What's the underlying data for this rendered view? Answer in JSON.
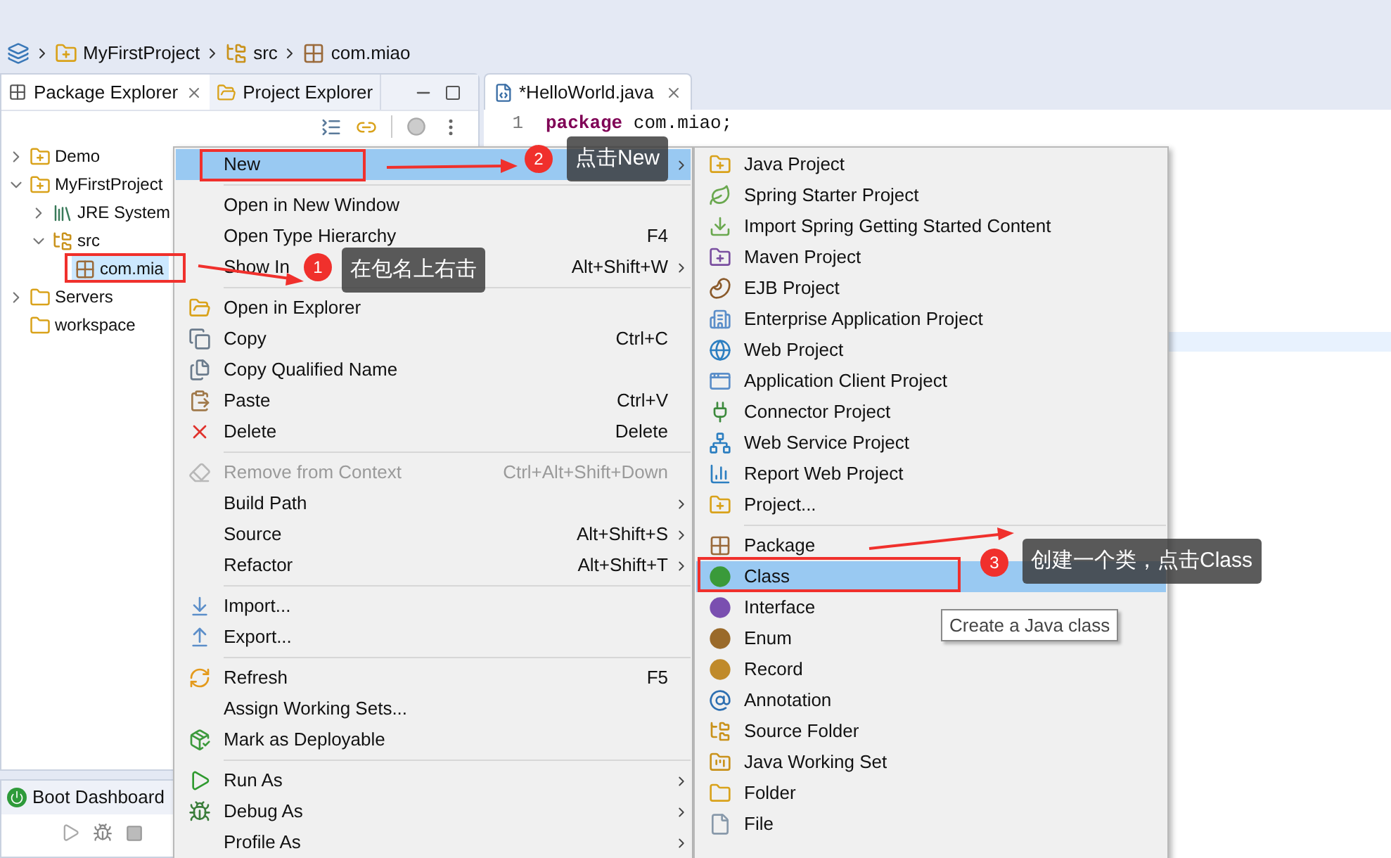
{
  "breadcrumb": [
    {
      "kind": "project",
      "label": "MyFirstProject"
    },
    {
      "kind": "source-folder",
      "label": "src"
    },
    {
      "kind": "package",
      "label": "com.miao"
    }
  ],
  "explorer": {
    "tabs": [
      {
        "label": "Package Explorer",
        "selected": true
      },
      {
        "label": "Project Explorer",
        "selected": false
      }
    ],
    "tree": [
      {
        "label": "Demo",
        "kind": "project",
        "expanded": false,
        "selected": false
      },
      {
        "label": "MyFirstProject",
        "kind": "project",
        "expanded": true,
        "selected": false,
        "children": [
          {
            "label": "JRE System",
            "kind": "library",
            "expanded": false,
            "selected": false
          },
          {
            "label": "src",
            "kind": "source-folder",
            "expanded": true,
            "selected": false,
            "children": [
              {
                "label": "com.mia",
                "kind": "package",
                "selected": true
              }
            ]
          }
        ]
      },
      {
        "label": "Servers",
        "kind": "folder",
        "expanded": false,
        "selected": false
      },
      {
        "label": "workspace",
        "kind": "folder",
        "selected": false
      }
    ]
  },
  "editor": {
    "tab": "*HelloWorld.java",
    "lines": [
      {
        "number": "1",
        "tokens": [
          {
            "text": "package",
            "kind": "keyword"
          },
          {
            "text": " com.miao;",
            "kind": "plain"
          }
        ]
      }
    ]
  },
  "context_menu": {
    "items": [
      {
        "kind": "plain",
        "label": "New",
        "submenu": true,
        "selected": true,
        "disabled": false
      },
      {
        "kind": "separator"
      },
      {
        "kind": "plain",
        "label": "Open in New Window",
        "selected": false,
        "disabled": false
      },
      {
        "kind": "plain",
        "label": "Open Type Hierarchy",
        "shortcut": "F4",
        "selected": false,
        "disabled": false
      },
      {
        "kind": "plain",
        "label": "Show In",
        "shortcut": "Alt+Shift+W",
        "submenu": true,
        "selected": false,
        "disabled": false
      },
      {
        "kind": "separator"
      },
      {
        "kind": "open-explorer",
        "label": "Open in Explorer",
        "selected": false,
        "disabled": false
      },
      {
        "kind": "copy",
        "label": "Copy",
        "shortcut": "Ctrl+C",
        "selected": false,
        "disabled": false
      },
      {
        "kind": "copy-name",
        "label": "Copy Qualified Name",
        "selected": false,
        "disabled": false
      },
      {
        "kind": "paste",
        "label": "Paste",
        "shortcut": "Ctrl+V",
        "selected": false,
        "disabled": false
      },
      {
        "kind": "delete",
        "label": "Delete",
        "shortcut": "Delete",
        "selected": false,
        "disabled": false
      },
      {
        "kind": "separator"
      },
      {
        "kind": "remove",
        "label": "Remove from Context",
        "shortcut": "Ctrl+Alt+Shift+Down",
        "selected": false,
        "disabled": true
      },
      {
        "kind": "plain",
        "label": "Build Path",
        "submenu": true,
        "selected": false,
        "disabled": false
      },
      {
        "kind": "plain",
        "label": "Source",
        "shortcut": "Alt+Shift+S",
        "submenu": true,
        "selected": false,
        "disabled": false
      },
      {
        "kind": "plain",
        "label": "Refactor",
        "shortcut": "Alt+Shift+T",
        "submenu": true,
        "selected": false,
        "disabled": false
      },
      {
        "kind": "separator"
      },
      {
        "kind": "import",
        "label": "Import...",
        "selected": false,
        "disabled": false
      },
      {
        "kind": "export",
        "label": "Export...",
        "selected": false,
        "disabled": false
      },
      {
        "kind": "separator"
      },
      {
        "kind": "refresh",
        "label": "Refresh",
        "shortcut": "F5",
        "selected": false,
        "disabled": false
      },
      {
        "kind": "plain",
        "label": "Assign Working Sets...",
        "selected": false,
        "disabled": false
      },
      {
        "kind": "deploy",
        "label": "Mark as Deployable",
        "selected": false,
        "disabled": false
      },
      {
        "kind": "separator"
      },
      {
        "kind": "run",
        "label": "Run As",
        "submenu": true,
        "selected": false,
        "disabled": false
      },
      {
        "kind": "debug",
        "label": "Debug As",
        "submenu": true,
        "selected": false,
        "disabled": false
      },
      {
        "kind": "plain",
        "label": "Profile As",
        "submenu": true,
        "selected": false,
        "disabled": false
      }
    ]
  },
  "new_submenu": {
    "items": [
      {
        "kind": "java-project",
        "label": "Java Project",
        "selected": false
      },
      {
        "kind": "spring",
        "label": "Spring Starter Project",
        "selected": false
      },
      {
        "kind": "spring-import",
        "label": "Import Spring Getting Started Content",
        "selected": false
      },
      {
        "kind": "maven",
        "label": "Maven Project",
        "selected": false
      },
      {
        "kind": "ejb",
        "label": "EJB Project",
        "selected": false
      },
      {
        "kind": "ear",
        "label": "Enterprise Application Project",
        "selected": false
      },
      {
        "kind": "web",
        "label": "Web Project",
        "selected": false
      },
      {
        "kind": "app-client",
        "label": "Application Client Project",
        "selected": false
      },
      {
        "kind": "connector",
        "label": "Connector Project",
        "selected": false
      },
      {
        "kind": "web-service",
        "label": "Web Service Project",
        "selected": false
      },
      {
        "kind": "report",
        "label": "Report Web Project",
        "selected": false
      },
      {
        "kind": "project",
        "label": "Project...",
        "selected": false
      },
      {
        "kind": "separator"
      },
      {
        "kind": "package",
        "label": "Package",
        "selected": false
      },
      {
        "kind": "class",
        "label": "Class",
        "selected": true
      },
      {
        "kind": "interface",
        "label": "Interface",
        "selected": false
      },
      {
        "kind": "enum",
        "label": "Enum",
        "selected": false
      },
      {
        "kind": "record",
        "label": "Record",
        "selected": false
      },
      {
        "kind": "annotation",
        "label": "Annotation",
        "selected": false
      },
      {
        "kind": "source-folder",
        "label": "Source Folder",
        "selected": false
      },
      {
        "kind": "working-set",
        "label": "Java Working Set",
        "selected": false
      },
      {
        "kind": "folder",
        "label": "Folder",
        "selected": false
      },
      {
        "kind": "file",
        "label": "File",
        "selected": false
      }
    ]
  },
  "tooltip": "Create a Java class",
  "annotations": [
    {
      "number": "1",
      "text": "在包名上右击"
    },
    {
      "number": "2",
      "text": "点击New"
    },
    {
      "number": "3",
      "text": "创建一个类，点击Class"
    }
  ],
  "boot_dashboard": {
    "title": "Boot Dashboard"
  }
}
